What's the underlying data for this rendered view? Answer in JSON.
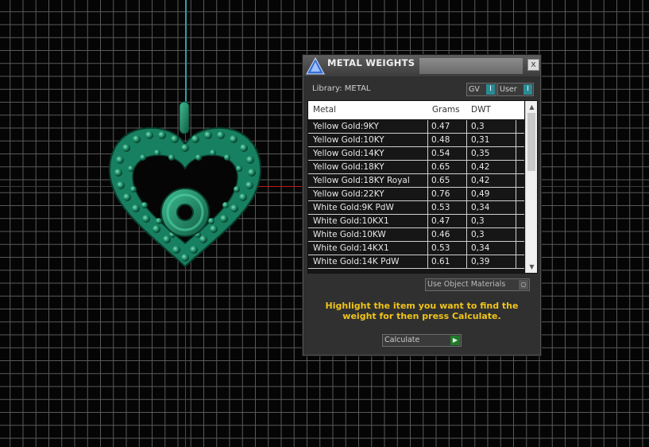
{
  "panel": {
    "title": "METAL WEIGHTS",
    "close_label": "x",
    "library_label": "Library: METAL",
    "gv_label": "GV",
    "user_label": "User",
    "toggle_knob": "I",
    "use_object_materials": "Use Object Materials",
    "use_object_knob": "○",
    "hint": "Highlight the item you want to find the weight for then press Calculate.",
    "calculate_label": "Calculate",
    "calculate_knob": "▶"
  },
  "table": {
    "headers": [
      "Metal",
      "Grams",
      "DWT"
    ],
    "rows": [
      [
        "Yellow Gold:9KY",
        "0.47",
        "0,3"
      ],
      [
        "Yellow Gold:10KY",
        "0.48",
        "0,31"
      ],
      [
        "Yellow Gold:14KY",
        "0.54",
        "0,35"
      ],
      [
        "Yellow Gold:18KY",
        "0.65",
        "0,42"
      ],
      [
        "Yellow Gold:18KY Royal",
        "0.65",
        "0,42"
      ],
      [
        "Yellow Gold:22KY",
        "0.76",
        "0,49"
      ],
      [
        "White Gold:9K PdW",
        "0.53",
        "0,34"
      ],
      [
        "White Gold:10KX1",
        "0.47",
        "0,3"
      ],
      [
        "White Gold:10KW",
        "0.46",
        "0,3"
      ],
      [
        "White Gold:14KX1",
        "0.53",
        "0,34"
      ],
      [
        "White Gold:14K PdW",
        "0.61",
        "0,39"
      ]
    ]
  },
  "icons": {
    "scroll_up": "▲",
    "scroll_down": "▼"
  },
  "colors": {
    "pendant": "#1a8a66",
    "hint_text": "#f0c419",
    "axis_red": "#c01818",
    "axis_cyan": "#2f9fa8"
  }
}
